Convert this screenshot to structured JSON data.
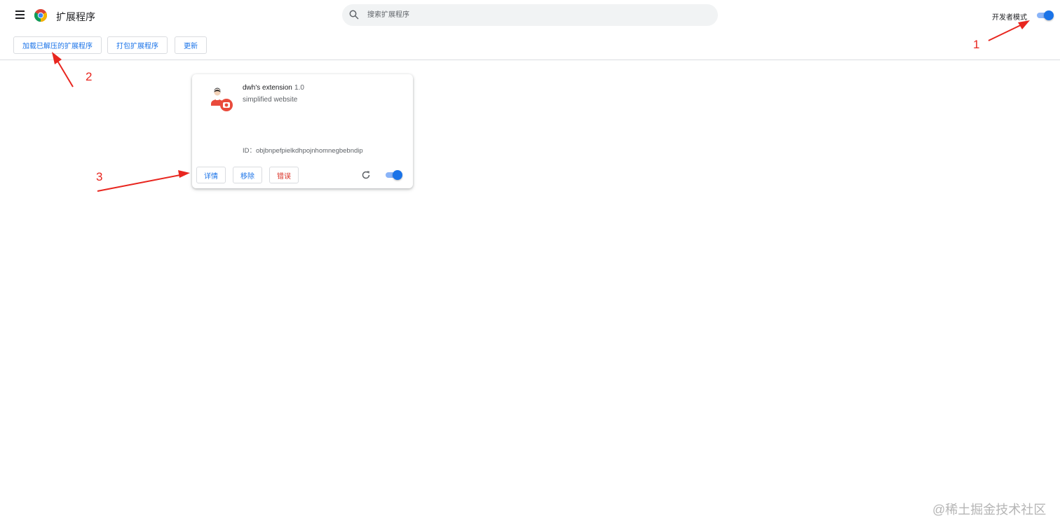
{
  "header": {
    "title": "扩展程序",
    "search_placeholder": "搜索扩展程序",
    "dev_mode_label": "开发者模式",
    "dev_mode_on": true
  },
  "toolbar": {
    "load_unpacked": "加载已解压的扩展程序",
    "pack_extension": "打包扩展程序",
    "update": "更新"
  },
  "extension": {
    "name": "dwh's extension",
    "version": "1.0",
    "description": "simplified website",
    "id_label": "ID：",
    "id": "objbnpefpielkdhpojnhomnegbebndip",
    "details_label": "详情",
    "remove_label": "移除",
    "errors_label": "错误",
    "enabled": true
  },
  "annotations": [
    "1",
    "2",
    "3"
  ],
  "watermark": "@稀土掘金技术社区",
  "colors": {
    "accent": "#1a73e8",
    "error": "#d93025",
    "annotation": "#e8261f"
  }
}
